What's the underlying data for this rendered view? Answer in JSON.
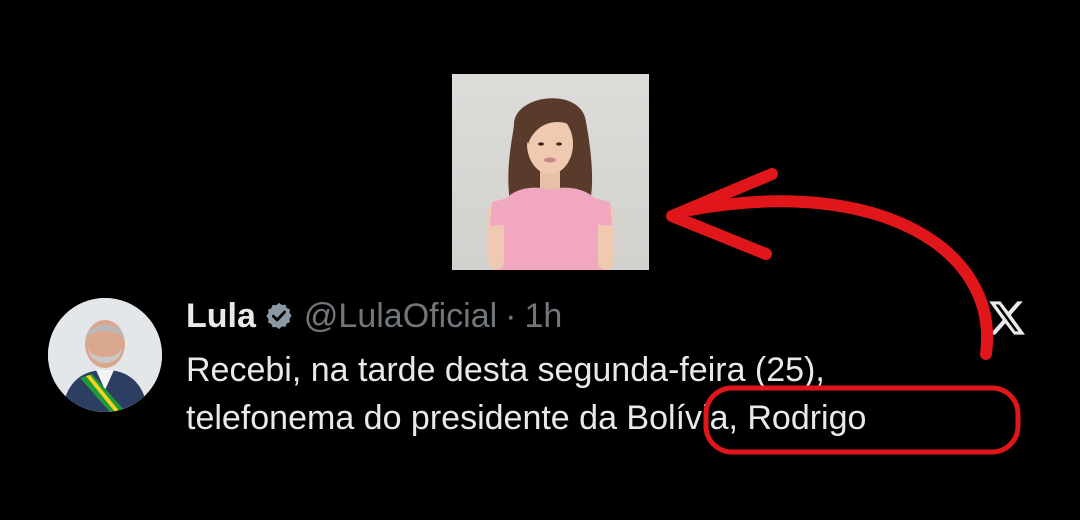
{
  "tweet": {
    "display_name": "Lula",
    "handle": "@LulaOficial",
    "separator": "·",
    "time": "1h",
    "text_line1": "Recebi, na tarde desta segunda-feira (25),",
    "text_line2": "telefonema do presidente da Bolívia, Rodrigo"
  },
  "icons": {
    "verified": "verified-badge-icon",
    "platform": "x-logo-icon"
  },
  "colors": {
    "background": "#000000",
    "text": "#e7e9ea",
    "muted": "#71767b",
    "annotation": "#e0161b"
  }
}
